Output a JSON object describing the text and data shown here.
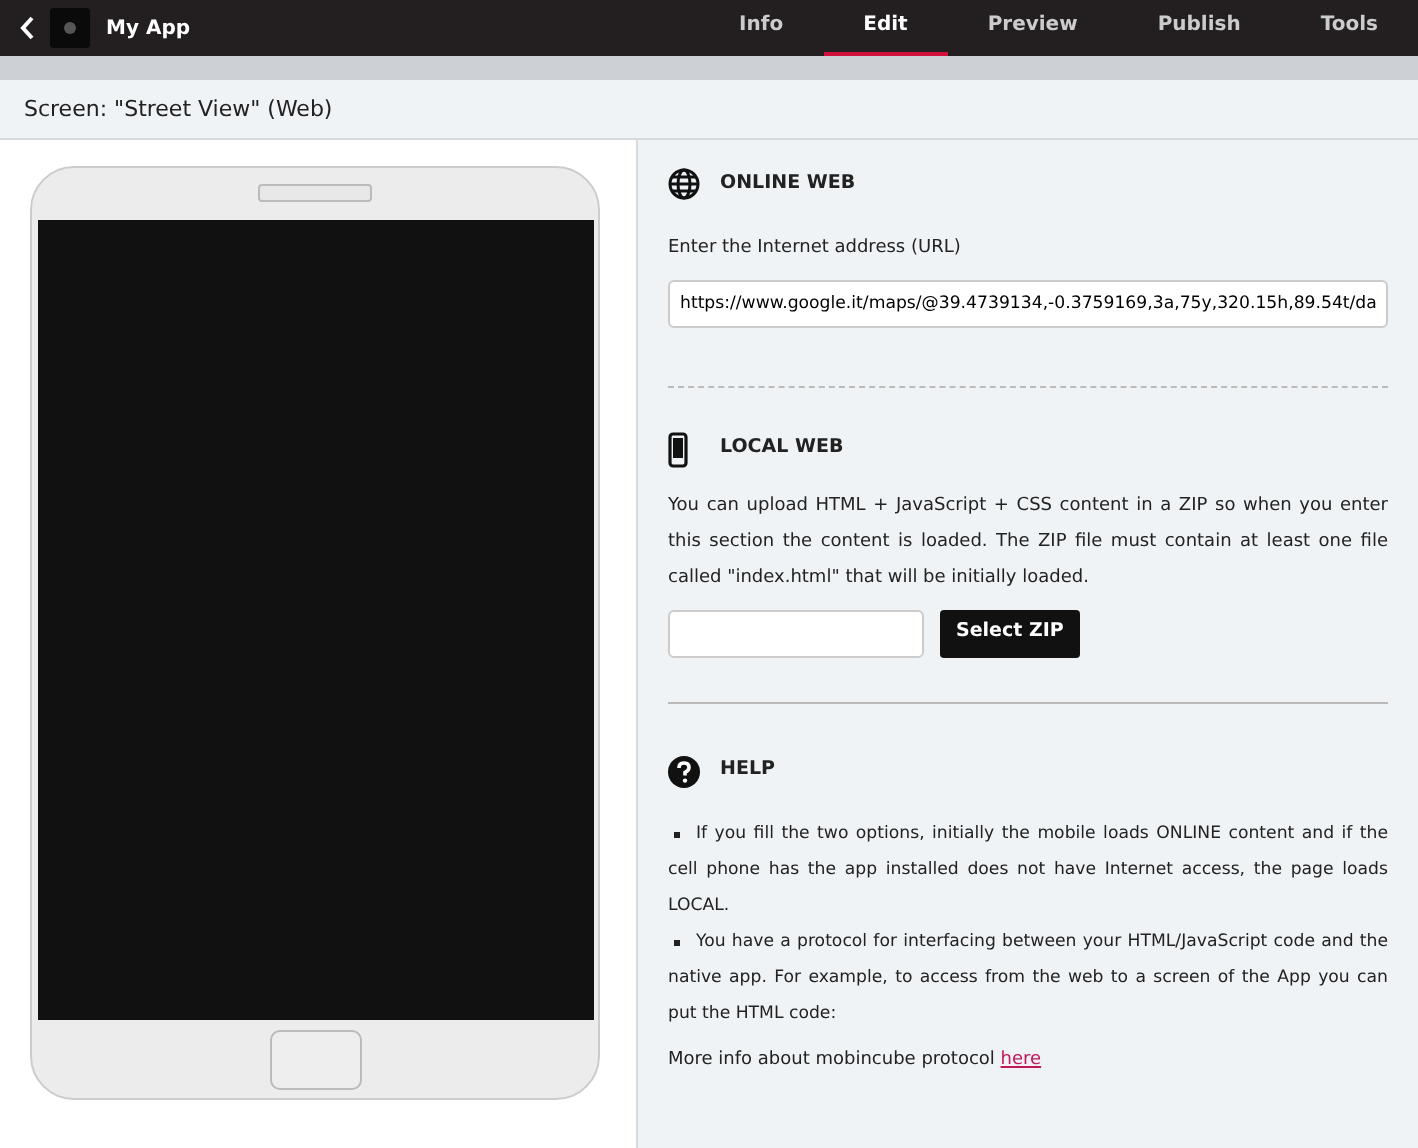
{
  "app": {
    "name": "My App"
  },
  "tabs": [
    {
      "label": "Info",
      "selected": false
    },
    {
      "label": "Edit",
      "selected": true
    },
    {
      "label": "Preview",
      "selected": false
    },
    {
      "label": "Publish",
      "selected": false
    },
    {
      "label": "Tools",
      "selected": false
    }
  ],
  "screen_title": "Screen: \"Street View\" (Web)",
  "online": {
    "title": "ONLINE WEB",
    "label": "Enter the Internet address (URL)",
    "value": "https://www.google.it/maps/@39.4739134,-0.3759169,3a,75y,320.15h,89.54t/da"
  },
  "local": {
    "title": "LOCAL WEB",
    "text": "You can upload HTML + JavaScript + CSS content in a ZIP so when you enter this section the content is loaded. The ZIP file must contain at least one file called \"index.html\" that will be initially loaded.",
    "button": "Select ZIP"
  },
  "help": {
    "title": "HELP",
    "items": [
      "If you fill the two options, initially the mobile loads ONLINE content and if the cell phone has the app installed does not have Internet access, the page loads LOCAL.",
      "You have a protocol for interfacing between your HTML/JavaScript code and the native app. For example, to access from the web to a screen of the App you can put the HTML code:"
    ],
    "more": "More info about mobincube protocol",
    "link": "here"
  }
}
